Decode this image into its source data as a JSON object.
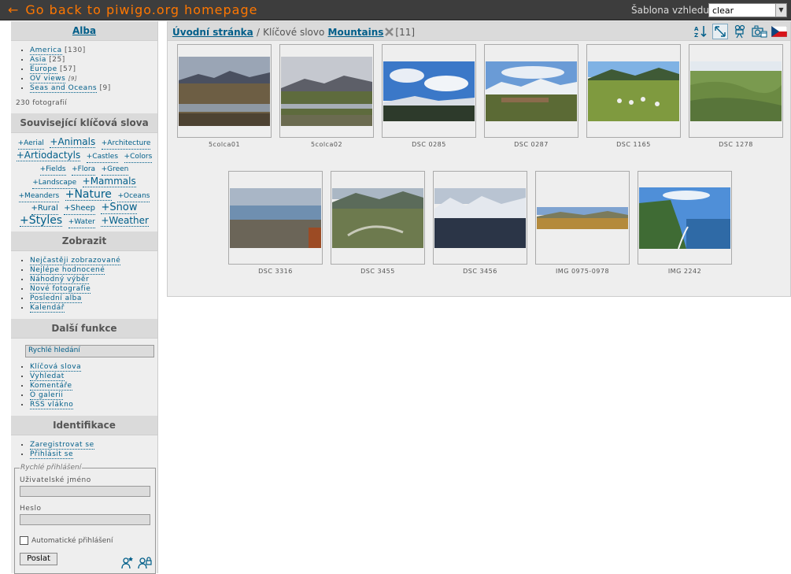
{
  "topbar": {
    "back_arrow": "←",
    "back_text": "Go back to piwigo.org homepage",
    "theme_label": "Šablona vzhledu",
    "theme_value": "clear"
  },
  "menubar": {
    "albums": {
      "title": "Alba",
      "items": [
        {
          "label": "America",
          "count": "[130]"
        },
        {
          "label": "Asia",
          "count": "[25]"
        },
        {
          "label": "Europe",
          "count": "[57]"
        },
        {
          "label": "OV views",
          "count": "[9]"
        },
        {
          "label": "Seas and Oceans",
          "count": "[9]"
        }
      ],
      "total": "230 fotografií"
    },
    "related_tags": {
      "title": "Související klíčová slova",
      "tags": [
        "+Aerial",
        "+Animals",
        "+Architecture",
        "+Artiodactyls",
        "+Castles",
        "+Colors",
        "+Fields",
        "+Flora",
        "+Green",
        "+Landscape",
        "+Mammals",
        "+Meanders",
        "+Nature",
        "+Oceans",
        "+Rural",
        "+Sheep",
        "+Snow",
        "+Styles",
        "+Water",
        "+Weather"
      ]
    },
    "show": {
      "title": "Zobrazit",
      "items": [
        "Nejčastěji zobrazované",
        "Nejlépe hodnocené",
        "Náhodný výběr",
        "Nové fotografie",
        "Poslední alba",
        "Kalendář"
      ]
    },
    "more": {
      "title": "Další funkce",
      "search_placeholder": "Rychlé hledání",
      "items": [
        "Klíčová slova",
        "Vyhledat",
        "Komentáře",
        "O galerii",
        "RSS vlákno"
      ]
    },
    "identification": {
      "title": "Identifikace",
      "items": [
        "Zaregistrovat se",
        "Přihlásit se"
      ],
      "quickconnect_legend": "Rychlé přihlášení",
      "username_label": "Uživatelské jméno",
      "password_label": "Heslo",
      "remember_label": "Automatické přihlášení",
      "submit_label": "Poslat"
    }
  },
  "content": {
    "breadcrumb": {
      "home": "Úvodní stránka",
      "sep": "/",
      "tag_prefix": "Klíčové slovo",
      "tag": "Mountains",
      "count": "[11]"
    },
    "thumbnails": [
      {
        "caption": "5colca01"
      },
      {
        "caption": "5colca02"
      },
      {
        "caption": "DSC 0285"
      },
      {
        "caption": "DSC 0287"
      },
      {
        "caption": "DSC 1165"
      },
      {
        "caption": "DSC 1278"
      },
      {
        "caption": "DSC 3316"
      },
      {
        "caption": "DSC 3455"
      },
      {
        "caption": "DSC 3456"
      },
      {
        "caption": "IMG 0975-0978"
      },
      {
        "caption": "IMG 2242"
      }
    ]
  },
  "colors": {
    "accent": "#ff7700",
    "link": "#005e89",
    "topbar": "#3d3d3d",
    "panel": "#eeeeee",
    "panel_head": "#dadada"
  }
}
